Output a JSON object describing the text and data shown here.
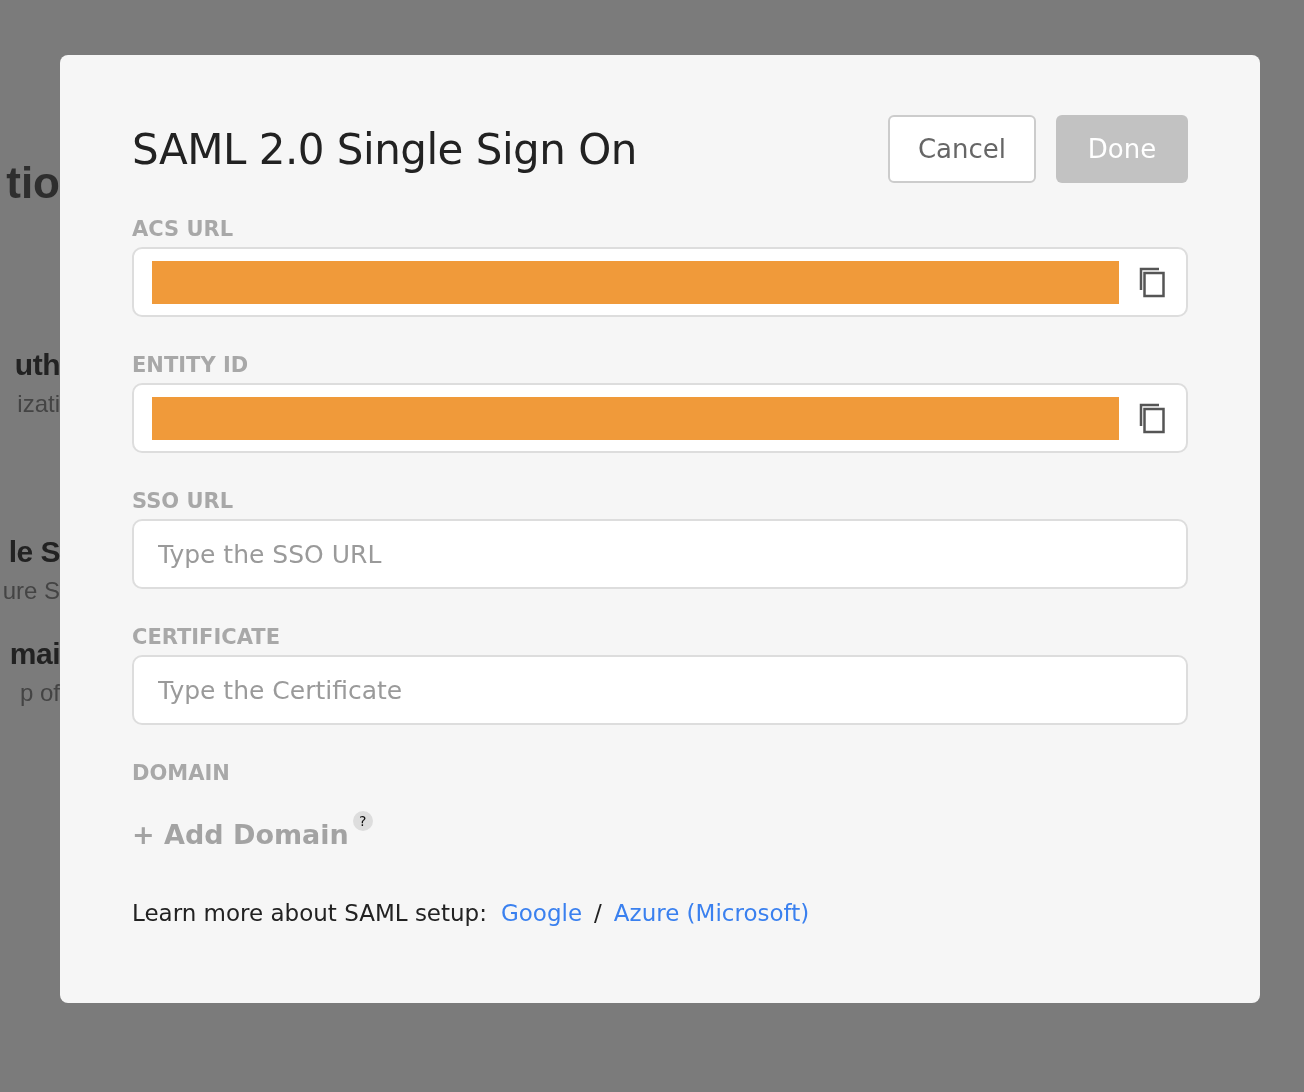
{
  "background": {
    "texts": [
      {
        "text": "tio",
        "kind": "heading"
      },
      {
        "text": "uth",
        "kind": "title"
      },
      {
        "text": "izati",
        "kind": "subtitle"
      },
      {
        "text": "le S",
        "kind": "title"
      },
      {
        "text": "ure S",
        "kind": "subtitle"
      },
      {
        "text": "mai",
        "kind": "title"
      },
      {
        "text": "p of",
        "kind": "subtitle"
      }
    ]
  },
  "dialog": {
    "title": "SAML 2.0 Single Sign On",
    "buttons": [
      {
        "label": "Cancel",
        "kind": "secondary",
        "disabled": false
      },
      {
        "label": "Done",
        "kind": "primary",
        "disabled": true
      }
    ],
    "fields": [
      {
        "label": "ACS URL",
        "redacted": true,
        "copyable": true
      },
      {
        "label": "ENTITY ID",
        "redacted": true,
        "copyable": true
      },
      {
        "label": "SSO URL",
        "placeholder": "Type the SSO URL"
      },
      {
        "label": "CERTIFICATE",
        "placeholder": "Type the Certificate"
      }
    ],
    "domain": {
      "label": "DOMAIN",
      "add_link": "+ Add Domain",
      "help": "?"
    },
    "learn_more": {
      "text": "Learn more about SAML setup:",
      "links": [
        "Google",
        "Azure (Microsoft)"
      ],
      "separator": "/"
    }
  }
}
